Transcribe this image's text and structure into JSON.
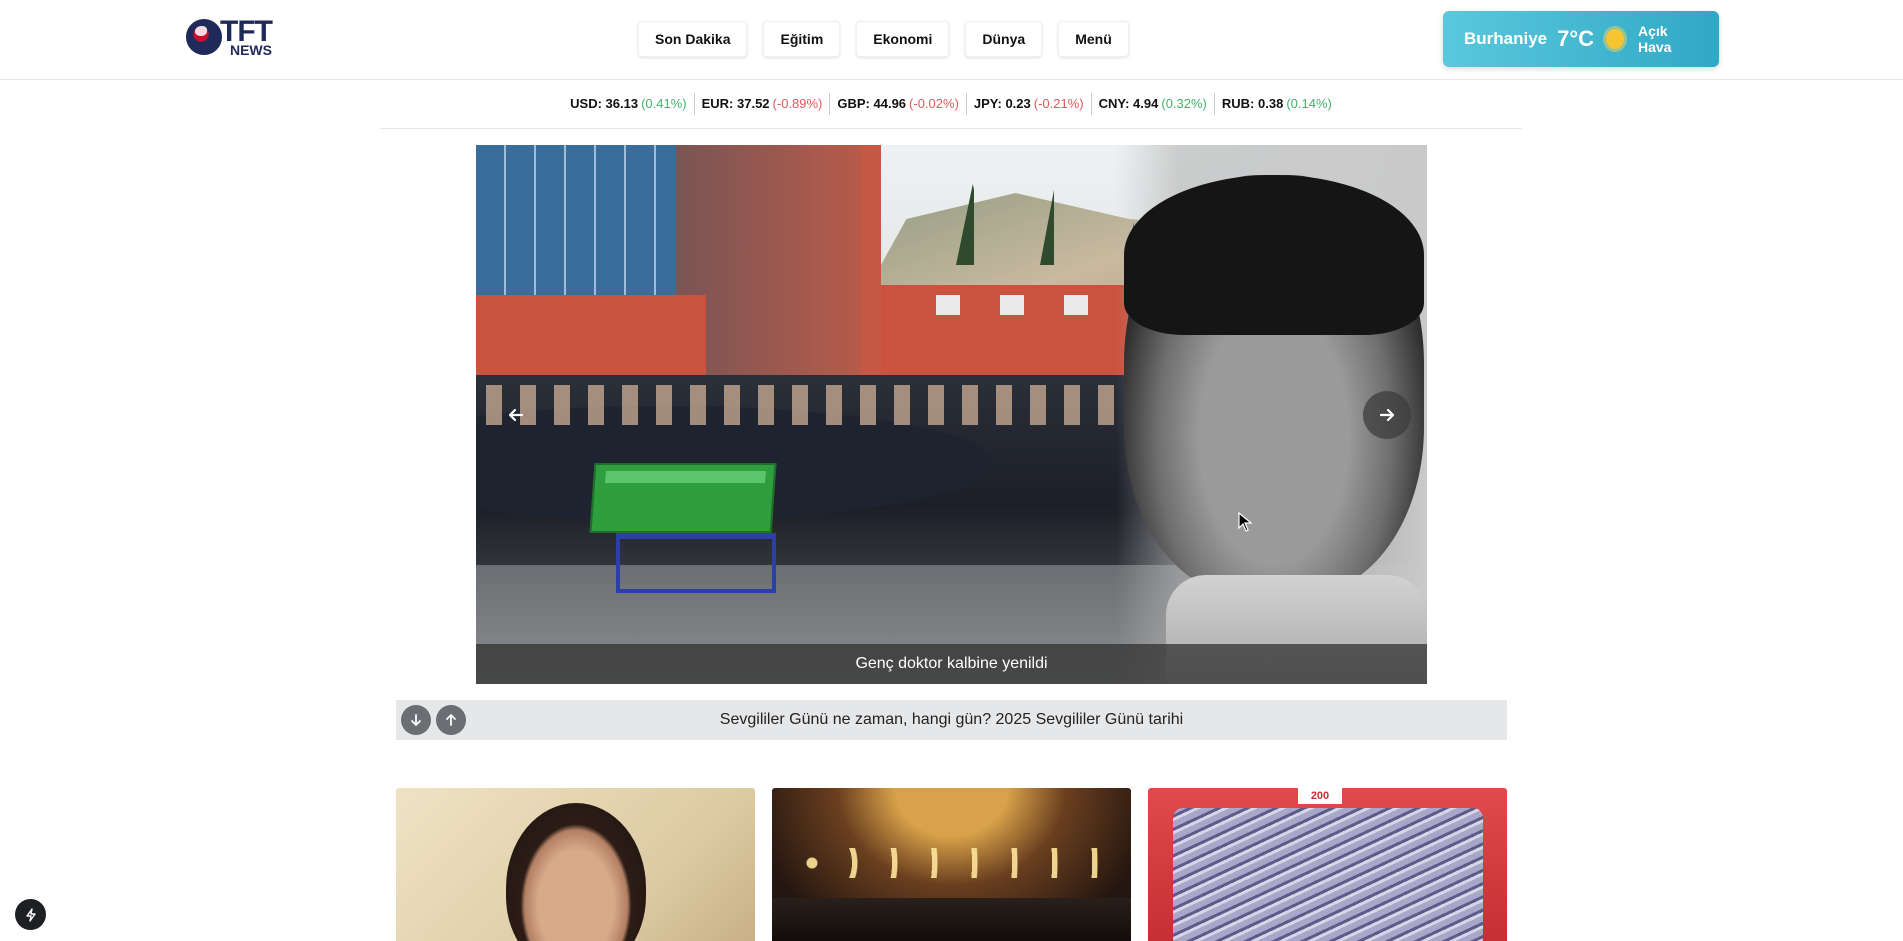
{
  "brand": {
    "logo_tft": "TFT",
    "logo_news": "NEWS"
  },
  "nav": {
    "items": [
      {
        "label": "Son Dakika"
      },
      {
        "label": "Eğitim"
      },
      {
        "label": "Ekonomi"
      },
      {
        "label": "Dünya"
      },
      {
        "label": "Menü"
      }
    ]
  },
  "weather": {
    "city": "Burhaniye",
    "temp": "7°C",
    "description": "Açık Hava",
    "icon": "sun-icon",
    "accent": "#30a8c6"
  },
  "currencies": [
    {
      "label": "USD: 36.13",
      "change": "(0.41%)",
      "direction": "up"
    },
    {
      "label": "EUR: 37.52",
      "change": "(-0.89%)",
      "direction": "down"
    },
    {
      "label": "GBP: 44.96",
      "change": "(-0.02%)",
      "direction": "down"
    },
    {
      "label": "JPY: 0.23",
      "change": "(-0.21%)",
      "direction": "down"
    },
    {
      "label": "CNY: 4.94",
      "change": "(0.32%)",
      "direction": "up"
    },
    {
      "label": "RUB: 0.38",
      "change": "(0.14%)",
      "direction": "up"
    }
  ],
  "slider": {
    "caption": "Genç doktor kalbine yenildi",
    "prev_icon": "arrow-left-icon",
    "next_icon": "arrow-right-icon"
  },
  "ticker": {
    "text": "Sevgililer Günü ne zaman, hangi gün? 2025 Sevgililer Günü tarihi",
    "down_icon": "arrow-down-icon",
    "up_icon": "arrow-up-icon"
  },
  "cards": [
    {
      "image": "portrait-photo"
    },
    {
      "image": "mosque-interior-photo"
    },
    {
      "image": "fish-market-photo",
      "tag": "200"
    }
  ],
  "colors": {
    "up": "#40b36a",
    "down": "#e0595b"
  }
}
